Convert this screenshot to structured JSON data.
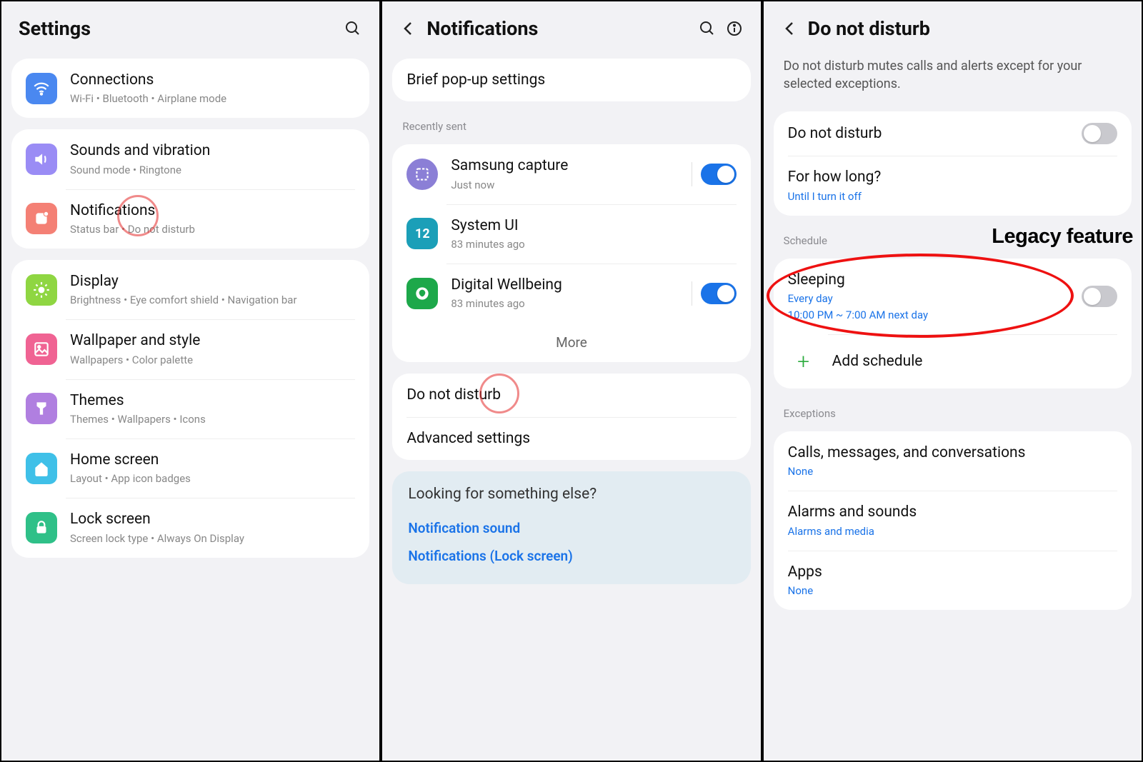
{
  "panel1": {
    "title": "Settings",
    "groups": [
      {
        "items": [
          {
            "icon": "wifi",
            "bg": "#4a88f0",
            "title": "Connections",
            "sub": "Wi-Fi  •  Bluetooth  •  Airplane mode"
          }
        ]
      },
      {
        "items": [
          {
            "icon": "sound",
            "bg": "#9a8cf5",
            "title": "Sounds and vibration",
            "sub": "Sound mode  •  Ringtone"
          },
          {
            "icon": "notif",
            "bg": "#f48075",
            "title": "Notifications",
            "sub": "Status bar  •  Do not disturb",
            "highlight": true
          }
        ]
      },
      {
        "items": [
          {
            "icon": "display",
            "bg": "#8fd642",
            "title": "Display",
            "sub": "Brightness  •  Eye comfort shield  •  Navigation bar"
          },
          {
            "icon": "wallpaper",
            "bg": "#f06393",
            "title": "Wallpaper and style",
            "sub": "Wallpapers  •  Color palette"
          },
          {
            "icon": "themes",
            "bg": "#b07fe0",
            "title": "Themes",
            "sub": "Themes  •  Wallpapers  •  Icons"
          },
          {
            "icon": "home",
            "bg": "#3fc0e8",
            "title": "Home screen",
            "sub": "Layout  •  App icon badges"
          },
          {
            "icon": "lock",
            "bg": "#2fc088",
            "title": "Lock screen",
            "sub": "Screen lock type  •  Always On Display"
          }
        ]
      }
    ]
  },
  "panel2": {
    "title": "Notifications",
    "brief_popup": "Brief pop-up settings",
    "recently_sent_label": "Recently sent",
    "recent": [
      {
        "icon": "capture",
        "bg": "#8b7fd6",
        "name": "Samsung capture",
        "time": "Just now",
        "toggle": true
      },
      {
        "icon": "systemui",
        "bg": "#1b9fb8",
        "name": "System UI",
        "time": "83 minutes ago",
        "toggle": null
      },
      {
        "icon": "wellbeing",
        "bg": "#1da84a",
        "name": "Digital Wellbeing",
        "time": "83 minutes ago",
        "toggle": true
      }
    ],
    "more": "More",
    "dnd": "Do not disturb",
    "advanced": "Advanced settings",
    "tip_title": "Looking for something else?",
    "tip_links": [
      "Notification sound",
      "Notifications (Lock screen)"
    ]
  },
  "panel3": {
    "title": "Do not disturb",
    "description": "Do not disturb mutes calls and alerts except for your selected exceptions.",
    "dnd_row": "Do not disturb",
    "dnd_toggle": false,
    "how_long": "For how long?",
    "how_long_value": "Until I turn it off",
    "schedule_label": "Schedule",
    "sleeping_title": "Sleeping",
    "sleeping_line1": "Every day",
    "sleeping_line2": "10:00 PM ~ 7:00 AM next day",
    "sleeping_toggle": false,
    "add_schedule": "Add schedule",
    "exceptions_label": "Exceptions",
    "exceptions": [
      {
        "title": "Calls, messages, and conversations",
        "value": "None"
      },
      {
        "title": "Alarms and sounds",
        "value": "Alarms and media"
      },
      {
        "title": "Apps",
        "value": "None"
      }
    ],
    "annotation": "Legacy feature"
  }
}
